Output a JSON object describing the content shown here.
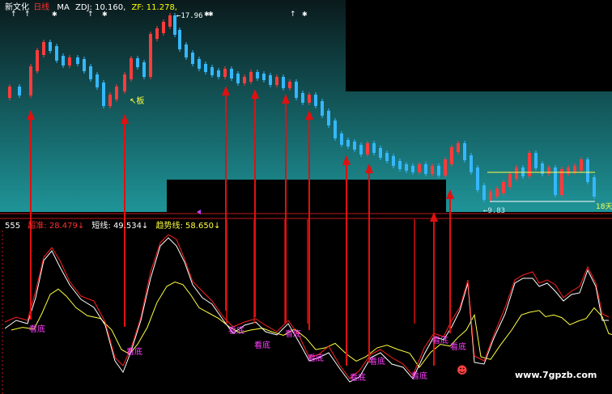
{
  "colors": {
    "background": "#000000",
    "upper_panel_top": "#0a1a1c",
    "upper_panel_bottom": "#1f8f92",
    "divider": "#c01818",
    "candle_up": "#ff3b3b",
    "candle_down": "#35b7ff",
    "arrow": "#e01010",
    "fast_line": "#ff2020",
    "short_line": "#ffffff",
    "trend_line": "#ffff40",
    "kandi_label": "#ff40ff",
    "header_white": "#ffffff",
    "header_yellow": "#ffff00",
    "header_red": "#ff3030",
    "watermark": "#ffffff"
  },
  "header": {
    "name": "新文化",
    "period": "日线",
    "ma": "MA",
    "zdj": "ZDJ: 10.160,",
    "zf": "ZF: 11.278,"
  },
  "upper_panel": {
    "high_label": "17.96",
    "low_label": "9.83",
    "board_label": "板",
    "days_label": "18天",
    "top_markers": [
      "↑",
      "↑",
      "↑",
      "↑"
    ]
  },
  "indicator": {
    "code": "555",
    "fast_label": "超准: 28.479↓",
    "short_label": "短线: 49.534↓",
    "trend_label": "趋势线: 58.650↓",
    "signal_label": "看底",
    "smiley": "☻"
  },
  "watermark": "www.7gpzb.com"
}
